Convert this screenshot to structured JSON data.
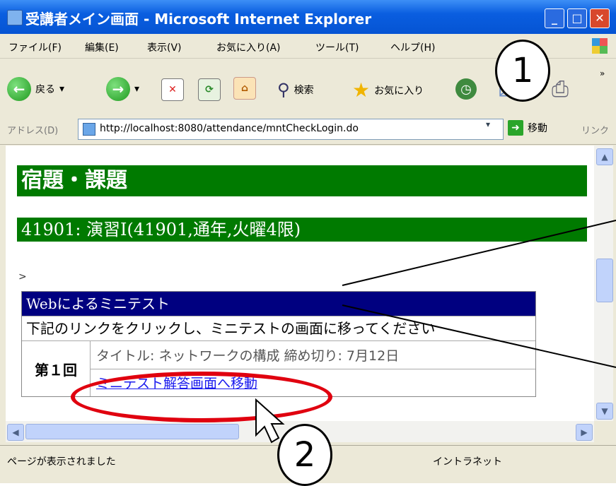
{
  "window": {
    "title": "受講者メイン画面 - Microsoft Internet Explorer",
    "min_glyph": "_",
    "max_glyph": "□",
    "close_glyph": "✕"
  },
  "menu": [
    "ファイル(F)",
    "編集(E)",
    "表示(V)",
    "お気に入り(A)",
    "ツール(T)",
    "ヘルプ(H)"
  ],
  "toolbar": {
    "back": "戻る",
    "back_glyph": "←",
    "forward_glyph": "→",
    "dropdown_glyph": "▾",
    "stop_glyph": "✕",
    "refresh_glyph": "⟳",
    "home_glyph": "⌂",
    "search": "検索",
    "search_glyph": "⚲",
    "favorites": "お気に入り",
    "favorites_glyph": "★",
    "history_glyph": "◷",
    "mail_glyph": "✉",
    "print_glyph": "⎙",
    "more": "»"
  },
  "address": {
    "label": "アドレス(D)",
    "url": "http://localhost:8080/attendance/mntCheckLogin.do",
    "go": "移動",
    "go_glyph": "➜",
    "links": "リンク"
  },
  "page": {
    "heading": "宿題・課題",
    "course": "41901: 演習Ⅰ(41901,通年,火曜4限)",
    "gt": ">",
    "minitest": {
      "header": "Webによるミニテスト",
      "instruction": "下記のリンクをクリックし、ミニテストの画面に移ってください",
      "round": "第１回",
      "title_line": "タイトル: ネットワークの構成 締め切り: 7月12日",
      "link": "ミニテスト解答画面へ移動"
    }
  },
  "scroll": {
    "up": "▲",
    "down": "▼",
    "left": "◀",
    "right": "▶"
  },
  "status": {
    "text": "ページが表示されました",
    "zone": "イントラネット"
  },
  "callouts": {
    "one": "1",
    "two": "2"
  },
  "colors": {
    "heading_bg": "#007a00",
    "table_header_bg": "#000080",
    "highlight": "#e0000f",
    "link": "#1a1aee"
  }
}
